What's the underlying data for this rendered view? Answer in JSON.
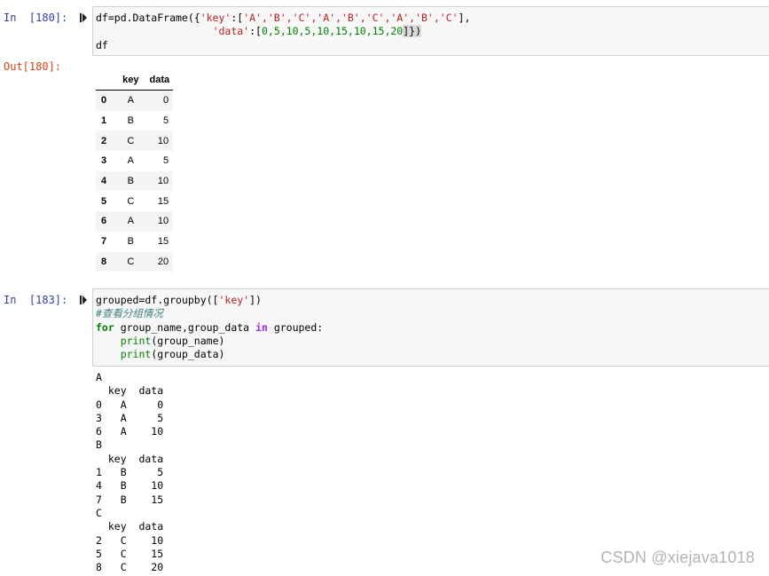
{
  "cell1": {
    "in_prompt": "In  [180]:",
    "out_prompt": "Out[180]:",
    "code": {
      "l1_a": "df=pd.DataFrame({",
      "l1_key": "'key'",
      "l1_b": ":[",
      "l1_vals": "'A','B','C','A','B','C','A','B','C'",
      "l1_c": "],",
      "l2_pad": "                   ",
      "l2_data": "'data'",
      "l2_b": ":[",
      "l2_nums": "0,5,10,5,10,15,10,15,20",
      "l2_c": "]})",
      "l3": "df"
    },
    "table": {
      "columns": [
        "key",
        "data"
      ],
      "rows": [
        {
          "index": "0",
          "key": "A",
          "data": "0"
        },
        {
          "index": "1",
          "key": "B",
          "data": "5"
        },
        {
          "index": "2",
          "key": "C",
          "data": "10"
        },
        {
          "index": "3",
          "key": "A",
          "data": "5"
        },
        {
          "index": "4",
          "key": "B",
          "data": "10"
        },
        {
          "index": "5",
          "key": "C",
          "data": "15"
        },
        {
          "index": "6",
          "key": "A",
          "data": "10"
        },
        {
          "index": "7",
          "key": "B",
          "data": "15"
        },
        {
          "index": "8",
          "key": "C",
          "data": "20"
        }
      ]
    }
  },
  "cell2": {
    "in_prompt": "In  [183]:",
    "code": {
      "l1_a": "grouped=df.groupby([",
      "l1_key": "'key'",
      "l1_b": "])",
      "l2_comment": "#查看分组情况",
      "l3_for": "for",
      "l3_a": " group_name,group_data ",
      "l3_in": "in",
      "l3_b": " grouped:",
      "l4_indent": "    ",
      "l4_print": "print",
      "l4_arg": "(group_name)",
      "l5_indent": "    ",
      "l5_print": "print",
      "l5_arg": "(group_data)"
    },
    "output": "A\n  key  data\n0   A     0\n3   A     5\n6   A    10\nB\n  key  data\n1   B     5\n4   B    10\n7   B    15\nC\n  key  data\n2   C    10\n5   C    15\n8   C    20"
  },
  "watermark": "CSDN @xiejava1018",
  "colors": {
    "in_prompt": "#303f9f",
    "out_prompt": "#d84315",
    "string": "#ba2121",
    "keyword": "#008000",
    "comment": "#408080"
  },
  "icons": {
    "run": "run-cell-icon"
  }
}
